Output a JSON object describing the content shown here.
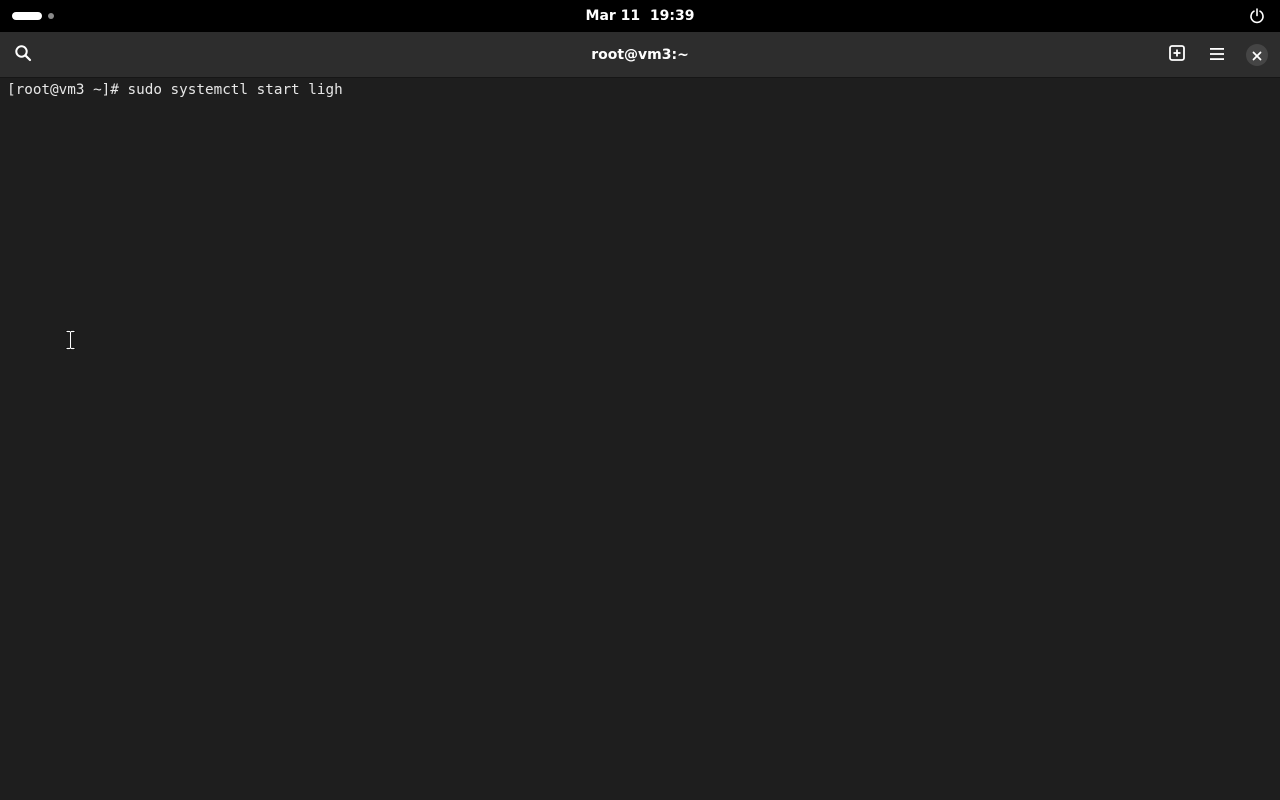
{
  "topbar": {
    "clock": "Mar 11  19:39"
  },
  "icons": {
    "activities": "workspace-indicator-icon",
    "power": "power-icon",
    "search": "search-icon",
    "new_tab": "new-tab-icon",
    "menu": "hamburger-menu-icon",
    "close": "close-icon",
    "cursor": "text-cursor-icon"
  },
  "window": {
    "title": "root@vm3:~"
  },
  "terminal": {
    "prompt": "[root@vm3 ~]# ",
    "command": "sudo systemctl start ligh"
  },
  "colors": {
    "topbar_bg": "#000000",
    "header_bg": "#2d2d2d",
    "terminal_bg": "#1e1e1e",
    "terminal_fg": "#e6e6e6"
  }
}
